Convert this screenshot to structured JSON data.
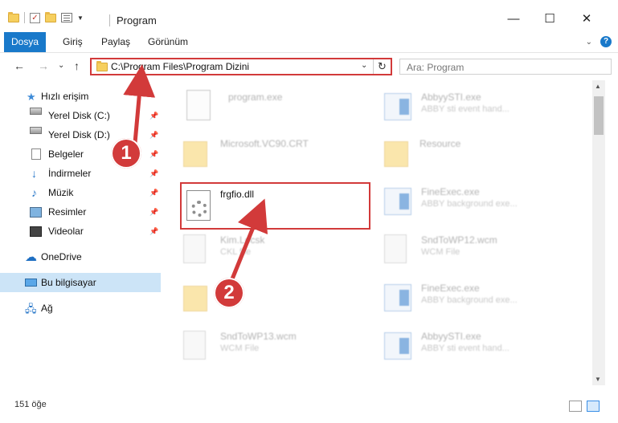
{
  "window": {
    "title": "Program",
    "minimize": "—",
    "maximize": "☐",
    "close": "✕"
  },
  "ribbon": {
    "tabs": [
      "Dosya",
      "Giriş",
      "Paylaş",
      "Görünüm"
    ]
  },
  "nav": {
    "back": "←",
    "forward": "→",
    "dropdown": "⌄",
    "up": "↑",
    "address": "C:\\Program Files\\Program Dizini",
    "refresh": "↻",
    "search_placeholder": "Ara: Program"
  },
  "sidebar": {
    "items": [
      {
        "label": "Hızlı erişim",
        "icon": "star-icon"
      },
      {
        "label": "Yerel Disk (C:)",
        "icon": "disk-icon",
        "pinned": true
      },
      {
        "label": "Yerel Disk (D:)",
        "icon": "disk-icon",
        "pinned": true
      },
      {
        "label": "Belgeler",
        "icon": "documents-icon",
        "pinned": true
      },
      {
        "label": "İndirmeler",
        "icon": "download-icon",
        "pinned": true
      },
      {
        "label": "Müzik",
        "icon": "music-icon",
        "pinned": true
      },
      {
        "label": "Resimler",
        "icon": "pictures-icon",
        "pinned": true
      },
      {
        "label": "Videolar",
        "icon": "video-icon",
        "pinned": true
      },
      {
        "label": "OneDrive",
        "icon": "cloud-icon"
      },
      {
        "label": "Bu bilgisayar",
        "icon": "computer-icon",
        "selected": true
      },
      {
        "label": "Ağ",
        "icon": "network-icon"
      }
    ]
  },
  "files": [
    {
      "name": "program.exe",
      "sub": "",
      "type": "app-gear"
    },
    {
      "name": "AbbyySTI.exe",
      "sub": "ABBY sti event hand...",
      "type": "app"
    },
    {
      "name": "Microsoft.VC90.CRT",
      "sub": "",
      "type": "folder"
    },
    {
      "name": "Resource",
      "sub": "",
      "type": "folder"
    },
    {
      "name": "FineExec.exe",
      "sub": "ABBY background exe...",
      "type": "app"
    },
    {
      "name": "Kim.Locsk",
      "sub": "CKL file",
      "type": "doc"
    },
    {
      "name": "SndToWP12.wcm",
      "sub": "WCM File",
      "type": "doc"
    },
    {
      "name": "",
      "sub": "",
      "type": "folder"
    },
    {
      "name": "FineExec.exe",
      "sub": "ABBY background exe...",
      "type": "app"
    },
    {
      "name": "SndToWP13.wcm",
      "sub": "WCM File",
      "type": "doc"
    },
    {
      "name": "AbbyySTI.exe",
      "sub": "ABBY sti event hand...",
      "type": "app"
    }
  ],
  "highlighted_file": {
    "name": "frgfio.dll",
    "icon": "dll-gear-icon"
  },
  "callouts": [
    "1",
    "2"
  ],
  "status": {
    "item_count": "151 öğe"
  },
  "colors": {
    "accent": "#1979ca",
    "highlight": "#d23a3a",
    "selected_nav": "#cce4f7"
  }
}
